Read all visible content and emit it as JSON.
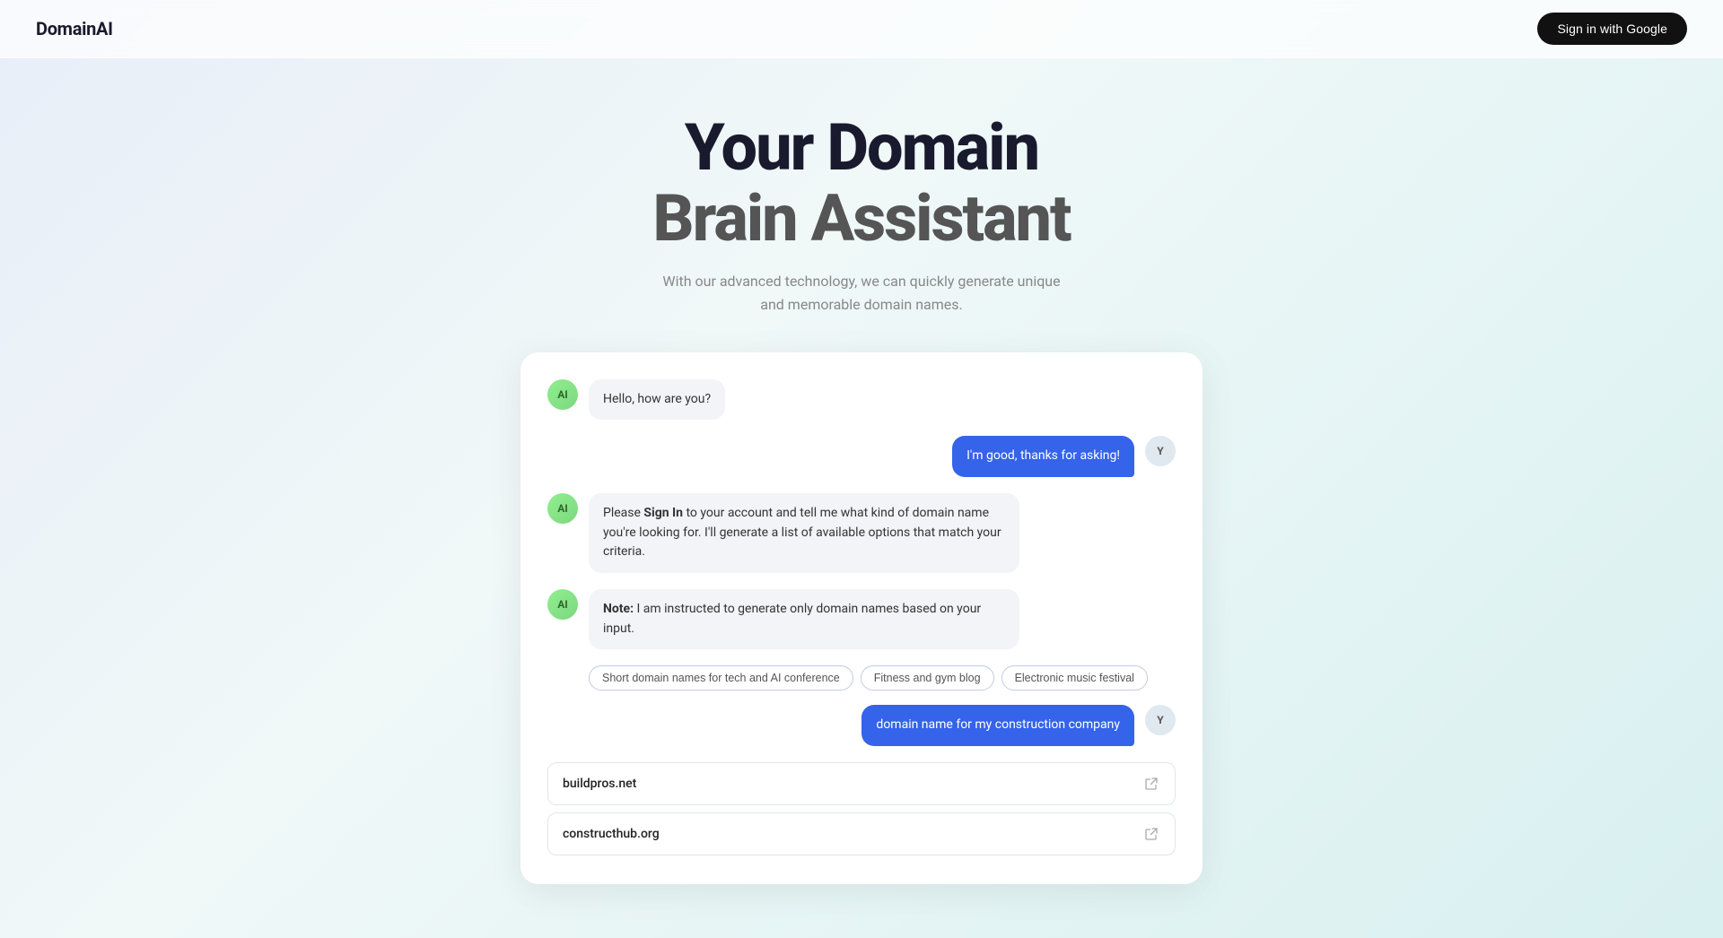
{
  "header": {
    "logo": "DomainAI",
    "sign_in_label": "Sign in with Google"
  },
  "hero": {
    "title_line1": "Your Domain",
    "title_line2": "Brain Assistant",
    "subtitle_line1": "With our advanced technology, we can quickly generate unique",
    "subtitle_line2": "and memorable domain names."
  },
  "chat": {
    "messages": [
      {
        "id": "msg1",
        "type": "ai",
        "avatar": "AI",
        "text": "Hello, how are you?"
      },
      {
        "id": "msg2",
        "type": "user",
        "avatar": "Y",
        "text": "I'm good, thanks for asking!"
      },
      {
        "id": "msg3",
        "type": "ai",
        "avatar": "AI",
        "text_html": "Please <b>Sign In</b> to your account and tell me what kind of domain name you're looking for. I'll generate a list of available options that match your criteria."
      },
      {
        "id": "msg4",
        "type": "ai",
        "avatar": "AI",
        "text_html": "<b>Note:</b> I am instructed to generate only domain names based on your input."
      }
    ],
    "chips": [
      "Short domain names for tech and AI conference",
      "Fitness and gym blog",
      "Electronic music festival"
    ],
    "user_query": "domain name for my construction company",
    "user_query_avatar": "Y",
    "domain_results": [
      "buildpros.net",
      "constructhub.org"
    ]
  }
}
